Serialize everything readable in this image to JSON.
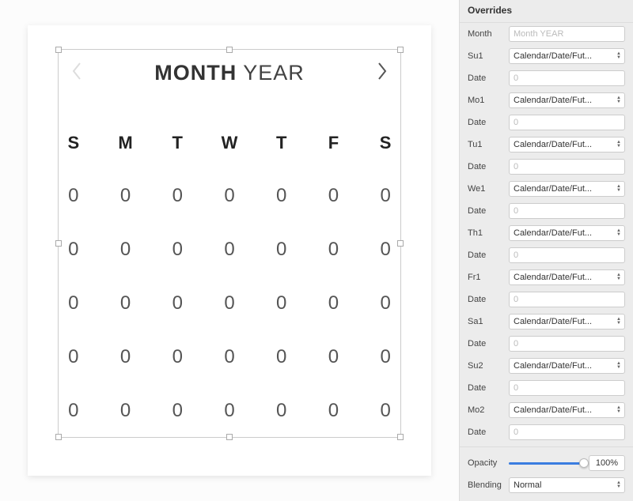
{
  "calendar": {
    "title_bold": "MONTH",
    "title_light": "YEAR",
    "dayheads": [
      "S",
      "M",
      "T",
      "W",
      "T",
      "F",
      "S"
    ],
    "dates": [
      [
        "0",
        "0",
        "0",
        "0",
        "0",
        "0",
        "0"
      ],
      [
        "0",
        "0",
        "0",
        "0",
        "0",
        "0",
        "0"
      ],
      [
        "0",
        "0",
        "0",
        "0",
        "0",
        "0",
        "0"
      ],
      [
        "0",
        "0",
        "0",
        "0",
        "0",
        "0",
        "0"
      ],
      [
        "0",
        "0",
        "0",
        "0",
        "0",
        "0",
        "0"
      ]
    ]
  },
  "inspector": {
    "section_title": "Overrides",
    "month_label": "Month",
    "month_placeholder": "Month YEAR",
    "select_value": "Calendar/Date/Fut...",
    "date_label": "Date",
    "date_placeholder": "0",
    "rows": [
      {
        "label": "Su1"
      },
      {
        "label": "Mo1"
      },
      {
        "label": "Tu1"
      },
      {
        "label": "We1"
      },
      {
        "label": "Th1"
      },
      {
        "label": "Fr1"
      },
      {
        "label": "Sa1"
      },
      {
        "label": "Su2"
      },
      {
        "label": "Mo2"
      }
    ],
    "opacity_label": "Opacity",
    "opacity_value": "100%",
    "blending_label": "Blending",
    "blending_value": "Normal"
  }
}
